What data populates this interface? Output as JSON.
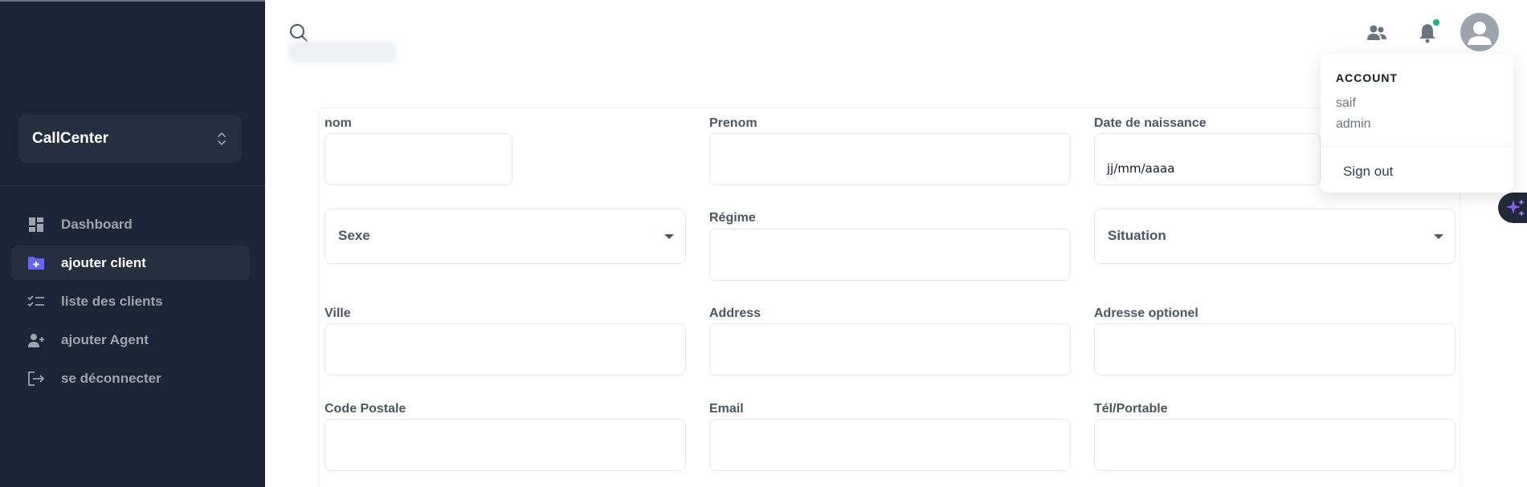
{
  "sidebar": {
    "brand": "CallCenter",
    "items": [
      {
        "label": "Dashboard",
        "icon": "dashboard-icon"
      },
      {
        "label": "ajouter client",
        "icon": "folder-add-icon",
        "active": true
      },
      {
        "label": "liste des clients",
        "icon": "checklist-icon"
      },
      {
        "label": "ajouter Agent",
        "icon": "user-add-icon"
      },
      {
        "label": "se déconnecter",
        "icon": "logout-icon"
      }
    ]
  },
  "topbar": {
    "search_icon": "search-icon",
    "users_icon": "users-icon",
    "bell_icon": "bell-icon",
    "avatar_icon": "user-avatar-icon"
  },
  "form": {
    "nom": "nom",
    "prenom": "Prenom",
    "date_naissance": "Date de naissance",
    "date_placeholder": "jj/mm/aaaa",
    "sexe": "Sexe",
    "regime": "Régime",
    "situation": "Situation",
    "ville": "Ville",
    "address": "Address",
    "adresse_opt": "Adresse optionel",
    "code_postale": "Code Postale",
    "email": "Email",
    "tel": "Tél/Portable"
  },
  "account_menu": {
    "heading": "ACCOUNT",
    "name": "saif",
    "role": "admin",
    "signout": "Sign out"
  },
  "colors": {
    "sidebar_bg": "#1c2536",
    "accent": "#6366f1",
    "status_online": "#10b981"
  }
}
